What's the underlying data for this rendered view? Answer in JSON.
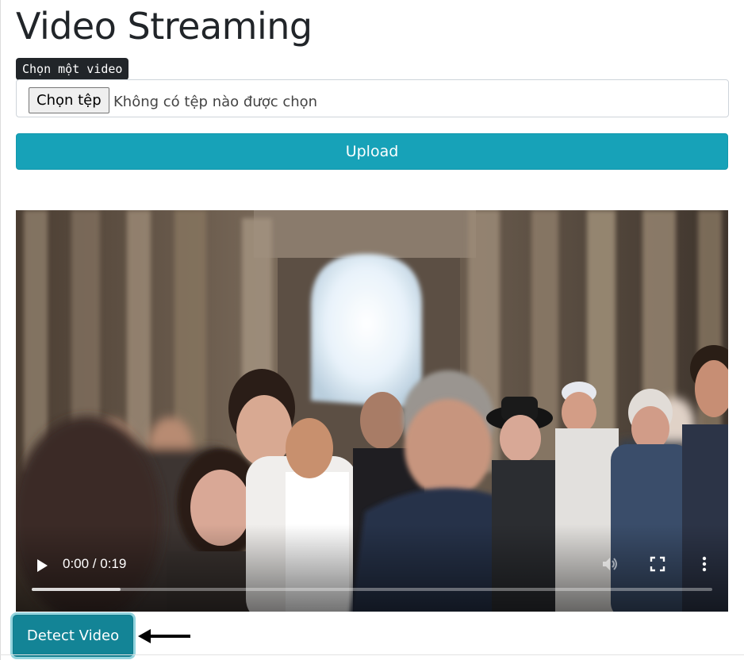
{
  "page": {
    "title": "Video Streaming"
  },
  "file_input": {
    "label": "Chọn một video",
    "button_label": "Chọn tệp",
    "status_text": "Không có tệp nào được chọn"
  },
  "upload": {
    "label": "Upload"
  },
  "video_player": {
    "time_display": "0:00 / 0:19",
    "buffered_fraction": 0.13,
    "icons": [
      "play-icon",
      "volume-icon",
      "fullscreen-icon",
      "more-options-icon"
    ]
  },
  "detect": {
    "label": "Detect Video"
  },
  "annotation": {
    "icon": "left-arrow-icon"
  },
  "colors": {
    "info": "#17a2b8",
    "info_active": "#138496",
    "dark": "#212529"
  }
}
